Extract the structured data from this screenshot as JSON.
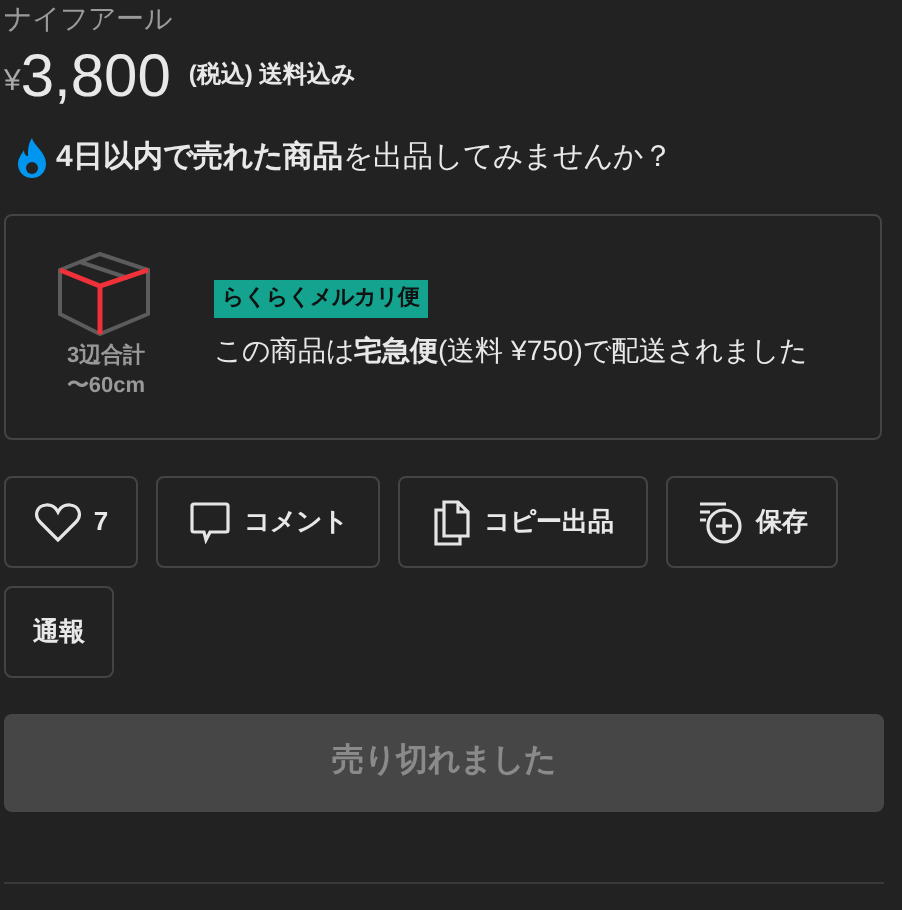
{
  "title": "ナイフアール",
  "price": {
    "currency": "¥",
    "amount": "3,800",
    "note": "(税込) 送料込み"
  },
  "promo": "**4日以内で売れた商品**を出品してみませんか？",
  "shipping": {
    "size": [
      "3辺合計",
      "〜60cm"
    ],
    "badge": "らくらくメルカリ便",
    "text": "この商品は**宅急便**(送料 ¥750)で配送されました"
  },
  "actions": [
    {
      "kind": "like",
      "label": "7"
    },
    {
      "kind": "comment",
      "label": "コメント"
    },
    {
      "kind": "copy",
      "label": "コピー出品"
    },
    {
      "kind": "save",
      "label": "保存"
    },
    {
      "kind": "report",
      "label": "通報"
    }
  ],
  "sold_button": {
    "label": "売り切れました",
    "disabled": true
  }
}
